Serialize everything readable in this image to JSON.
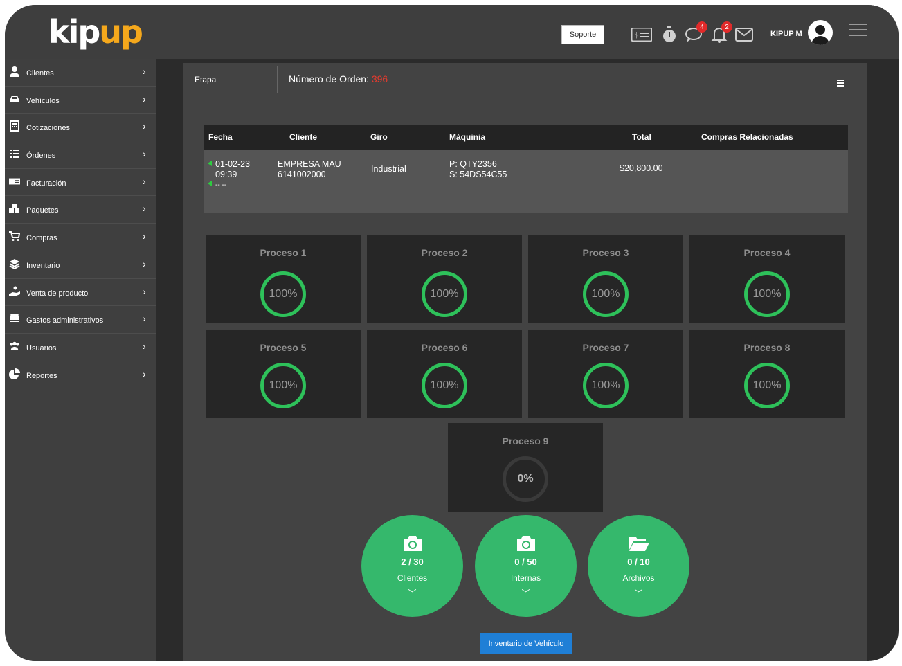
{
  "header": {
    "logo_part1": "kip",
    "logo_part2": "up",
    "support_label": "Soporte",
    "chat_badge": "4",
    "notif_badge": "2",
    "username": "KIPUP M"
  },
  "sidebar": {
    "items": [
      {
        "label": "Clientes",
        "icon": "user-icon"
      },
      {
        "label": "Vehículos",
        "icon": "car-icon"
      },
      {
        "label": "Cotizaciones",
        "icon": "calculator-icon"
      },
      {
        "label": "Órdenes",
        "icon": "list-icon"
      },
      {
        "label": "Facturación",
        "icon": "bill-icon"
      },
      {
        "label": "Paquetes",
        "icon": "cubes-icon"
      },
      {
        "label": "Compras",
        "icon": "cart-icon"
      },
      {
        "label": "Inventario",
        "icon": "layers-icon"
      },
      {
        "label": "Venta de producto",
        "icon": "hand-icon"
      },
      {
        "label": "Gastos administrativos",
        "icon": "coins-icon"
      },
      {
        "label": "Usuarios",
        "icon": "users-icon"
      },
      {
        "label": "Reportes",
        "icon": "pie-chart-icon"
      }
    ]
  },
  "main": {
    "etapa_label": "Etapa",
    "order_label": "Número de Orden:",
    "order_number": "396",
    "table": {
      "headers": [
        "Fecha",
        "Cliente",
        "Giro",
        "Máquinia",
        "Total",
        "Compras Relacionadas"
      ],
      "row": {
        "date": "01-02-23",
        "time": "09:39",
        "date2": "-- --",
        "client_name": "EMPRESA MAU",
        "client_phone": "6141002000",
        "giro": "Industrial",
        "machine_p": "P: QTY2356",
        "machine_s": "S: 54DS54C55",
        "total": "$20,800.00"
      }
    },
    "processes": [
      {
        "name": "Proceso 1",
        "progress": "100%"
      },
      {
        "name": "Proceso 2",
        "progress": "100%"
      },
      {
        "name": "Proceso 3",
        "progress": "100%"
      },
      {
        "name": "Proceso 4",
        "progress": "100%"
      },
      {
        "name": "Proceso 5",
        "progress": "100%"
      },
      {
        "name": "Proceso 6",
        "progress": "100%"
      },
      {
        "name": "Proceso 7",
        "progress": "100%"
      },
      {
        "name": "Proceso 8",
        "progress": "100%"
      },
      {
        "name": "Proceso 9",
        "progress": "0%"
      }
    ],
    "bubbles": [
      {
        "count": "2 / 30",
        "label": "Clientes",
        "icon": "camera-icon"
      },
      {
        "count": "0 / 50",
        "label": "Internas",
        "icon": "camera-icon"
      },
      {
        "count": "0 / 10",
        "label": "Archivos",
        "icon": "folder-open-icon"
      }
    ],
    "inventory_button": "Inventario de Vehículo"
  },
  "colors": {
    "accent_green": "#35b86c",
    "ring_green": "#2ec15a",
    "order_red": "#e63b2e",
    "logo_orange": "#f5a81c",
    "button_blue": "#1f7fd6"
  }
}
